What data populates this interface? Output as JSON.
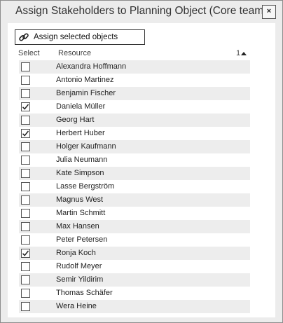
{
  "dialog": {
    "title": "Assign Stakeholders to Planning Object (Core team)",
    "close_label": "×"
  },
  "toolbar": {
    "assign_label": "Assign selected objects",
    "assign_icon": "link-icon"
  },
  "table": {
    "col_select": "Select",
    "col_resource": "Resource",
    "sort_indicator": "1",
    "sort_direction": "ascending",
    "rows": [
      {
        "name": "Alexandra Hoffmann",
        "checked": false
      },
      {
        "name": "Antonio Martinez",
        "checked": false
      },
      {
        "name": "Benjamin Fischer",
        "checked": false
      },
      {
        "name": "Daniela Müller",
        "checked": true
      },
      {
        "name": "Georg Hart",
        "checked": false
      },
      {
        "name": "Herbert Huber",
        "checked": true
      },
      {
        "name": "Holger Kaufmann",
        "checked": false
      },
      {
        "name": "Julia Neumann",
        "checked": false
      },
      {
        "name": "Kate Simpson",
        "checked": false
      },
      {
        "name": "Lasse Bergström",
        "checked": false
      },
      {
        "name": "Magnus West",
        "checked": false
      },
      {
        "name": "Martin Schmitt",
        "checked": false
      },
      {
        "name": "Max Hansen",
        "checked": false
      },
      {
        "name": "Peter Petersen",
        "checked": false
      },
      {
        "name": "Ronja Koch",
        "checked": true
      },
      {
        "name": "Rudolf Meyer",
        "checked": false
      },
      {
        "name": "Semir Yildirim",
        "checked": false
      },
      {
        "name": "Thomas Schäfer",
        "checked": false
      },
      {
        "name": "Wera Heine",
        "checked": false
      }
    ]
  },
  "colors": {
    "row_alt": "#ededed",
    "dialog_bg": "#ececec"
  }
}
